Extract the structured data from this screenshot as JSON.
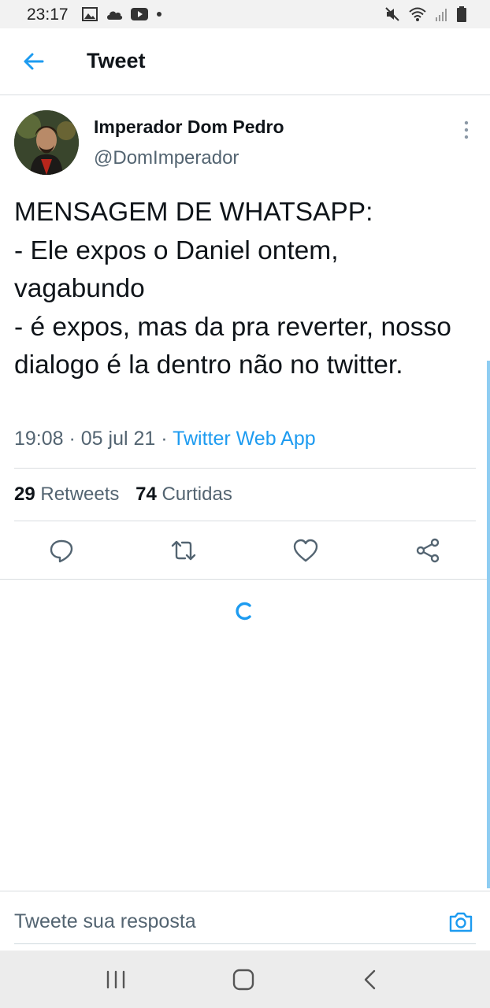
{
  "status_bar": {
    "time": "23:17",
    "left_icons": [
      "gallery-icon",
      "cloud-icon",
      "youtube-icon",
      "dot-icon"
    ],
    "right_icons": [
      "mute-icon",
      "wifi-icon",
      "signal-icon",
      "battery-icon"
    ]
  },
  "header": {
    "title": "Tweet",
    "back_icon": "arrow-left-icon"
  },
  "tweet": {
    "author_name": "Imperador Dom Pedro",
    "author_handle": "@DomImperador",
    "text": "MENSAGEM DE WHATSAPP:\n- Ele expos o Daniel ontem, vagabundo\n- é expos, mas da pra reverter, nosso dialogo é la dentro não no twitter.",
    "time": "19:08",
    "date": "05 jul 21",
    "separator": " · ",
    "source": "Twitter Web App",
    "retweets_count": "29",
    "retweets_label": "Retweets",
    "likes_count": "74",
    "likes_label": "Curtidas"
  },
  "actions": [
    "reply-icon",
    "retweet-icon",
    "like-icon",
    "share-icon"
  ],
  "reply": {
    "placeholder": "Tweete sua resposta"
  },
  "colors": {
    "accent": "#1d9bf0",
    "secondary_text": "#536471",
    "divider": "#d9dde0"
  }
}
